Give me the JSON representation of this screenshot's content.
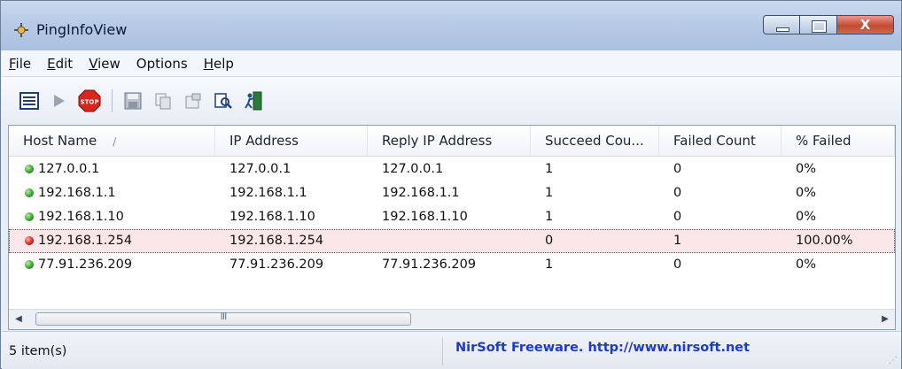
{
  "window": {
    "title": "PingInfoView"
  },
  "menu": [
    {
      "key": "F",
      "rest": "ile"
    },
    {
      "key": "E",
      "rest": "dit"
    },
    {
      "key": "V",
      "rest": "iew"
    },
    {
      "key": "",
      "rest": "Options"
    },
    {
      "key": "H",
      "rest": "elp"
    }
  ],
  "toolbar": {
    "icons": [
      "options-icon",
      "start-icon",
      "stop-icon",
      "save-icon",
      "copy-icon",
      "properties-icon",
      "find-icon",
      "exit-icon"
    ],
    "stop_label": "STOP"
  },
  "columns": [
    "Host Name",
    "IP Address",
    "Reply IP Address",
    "Succeed Cou...",
    "Failed Count",
    "% Failed"
  ],
  "sort_indicator": "/",
  "rows": [
    {
      "status": "ok",
      "host": "127.0.0.1",
      "ip": "127.0.0.1",
      "reply": "127.0.0.1",
      "succeed": "1",
      "failed": "0",
      "pct": "0%"
    },
    {
      "status": "ok",
      "host": "192.168.1.1",
      "ip": "192.168.1.1",
      "reply": "192.168.1.1",
      "succeed": "1",
      "failed": "0",
      "pct": "0%"
    },
    {
      "status": "ok",
      "host": "192.168.1.10",
      "ip": "192.168.1.10",
      "reply": "192.168.1.10",
      "succeed": "1",
      "failed": "0",
      "pct": "0%"
    },
    {
      "status": "fail",
      "host": "192.168.1.254",
      "ip": "192.168.1.254",
      "reply": "",
      "succeed": "0",
      "failed": "1",
      "pct": "100.00%"
    },
    {
      "status": "ok",
      "host": "77.91.236.209",
      "ip": "77.91.236.209",
      "reply": "77.91.236.209",
      "succeed": "1",
      "failed": "0",
      "pct": "0%"
    }
  ],
  "selected_row": 3,
  "scrollbar": {
    "left_arrow": "◀",
    "right_arrow": "▶",
    "grip": "III"
  },
  "status": {
    "count": "5 item(s)",
    "credit": "NirSoft Freeware.  http://www.nirsoft.net"
  },
  "window_buttons": {
    "close_label": "X"
  }
}
